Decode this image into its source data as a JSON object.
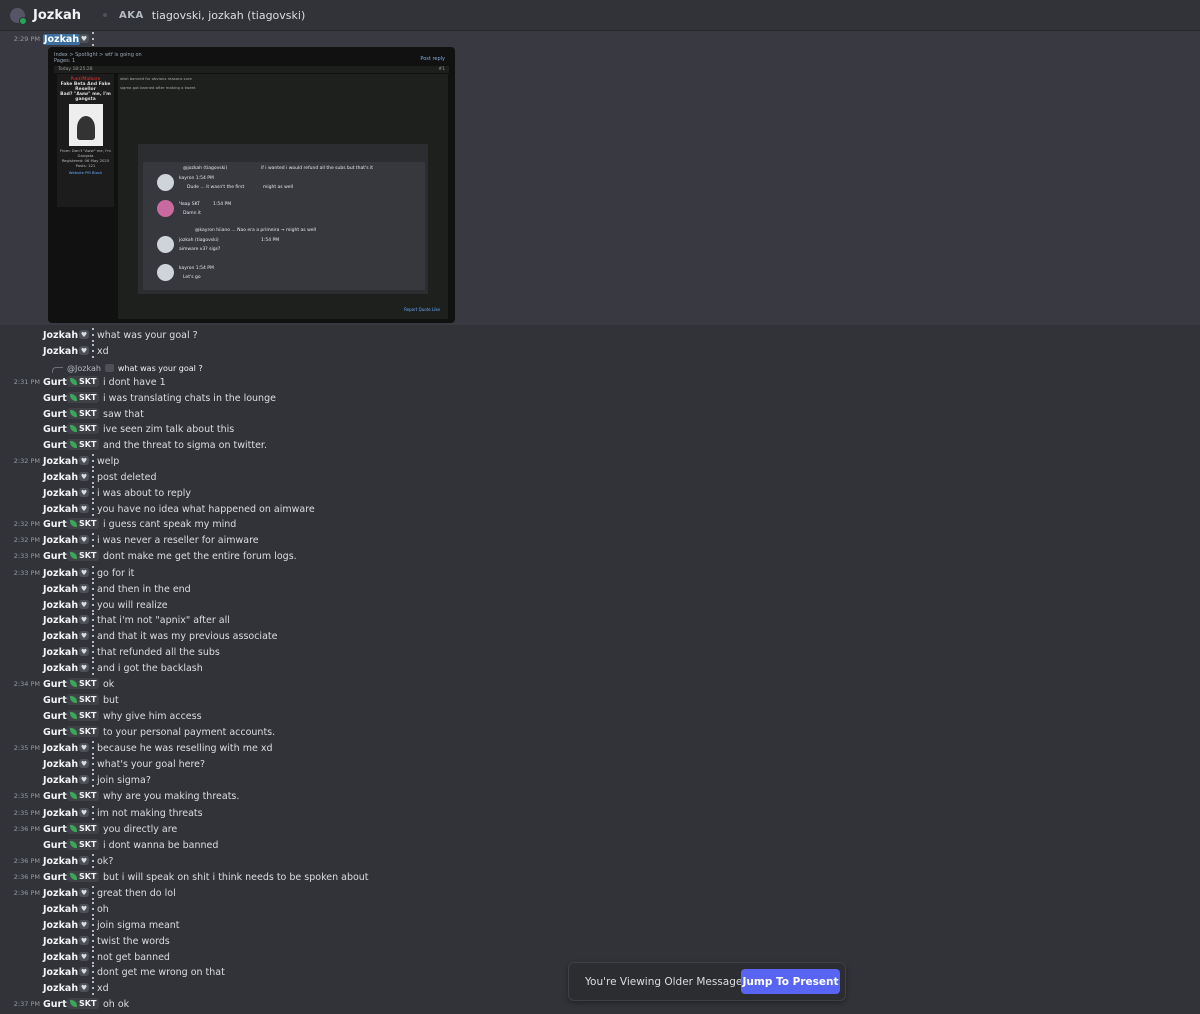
{
  "header": {
    "name": "Jozkah",
    "aka_label": "AKA",
    "aliases": "tiagovski, jozkah (tiagovski)"
  },
  "embed": {
    "breadcrumb": "Index > Spotlight > wtf is going on",
    "pages": "Pages: 1",
    "post_reply": "Post reply",
    "date": "Today 18:25:28",
    "post_no": "#1",
    "side_rank": "Ρυκέ/Μalbore",
    "side_sub": "Fake Beta And Fake Resellor",
    "side_caption": "Bad? \"Aww\" me, I'm gangsta",
    "side_info": [
      "From: Don't \"Aww\" me, I'm Gangsta",
      "Registered: 06 May 2025",
      "Posts: 121"
    ],
    "side_link": "Website PM Block",
    "intro_lines": [
      "wish banned for obvious reasons sure",
      "sigma got banned after making a tweet"
    ],
    "shot": {
      "m1": "@jozkah (tiagovski)",
      "m1_text": "if i wanted i would refund all the subs but that's it",
      "u1": "kayron 1:54 PM",
      "u1_text": "Dude ... it wasn't the first",
      "u1_side": "might as well",
      "u2": "Чвар SKT",
      "u2_time": "1:54 PM",
      "u2_text": "Damn it",
      "m2": "@kayron hiiano ... Nao era a primeira → might as well",
      "u3": "jozkah (tiagovski)",
      "u3_time": "1:54 PM",
      "u3_text": "aimware v3? sigs?",
      "u4": "kayron 1:54 PM",
      "u4_text": "Let's go"
    },
    "footer": "Report   Quote   Like"
  },
  "reply_preview": {
    "author": "@Jozkah",
    "text": "what was your goal ?"
  },
  "messages": [
    {
      "time": "2:29 PM",
      "user": "Jozkah",
      "text": ""
    },
    {
      "time": "",
      "user": "Jozkah",
      "text": "what was your goal ?"
    },
    {
      "time": "",
      "user": "Jozkah",
      "text": "xd"
    },
    {
      "time": "2:31 PM",
      "user": "Gurt",
      "tag": "SKT",
      "text": "i dont have 1"
    },
    {
      "time": "",
      "user": "Gurt",
      "tag": "SKT",
      "text": "i was translating chats in the lounge"
    },
    {
      "time": "",
      "user": "Gurt",
      "tag": "SKT",
      "text": "saw that"
    },
    {
      "time": "",
      "user": "Gurt",
      "tag": "SKT",
      "text": "ive seen zim talk about this"
    },
    {
      "time": "",
      "user": "Gurt",
      "tag": "SKT",
      "text": "and the threat to sigma on twitter."
    },
    {
      "time": "2:32 PM",
      "user": "Jozkah",
      "text": "welp"
    },
    {
      "time": "",
      "user": "Jozkah",
      "text": "post deleted"
    },
    {
      "time": "",
      "user": "Jozkah",
      "text": "i was about to reply"
    },
    {
      "time": "",
      "user": "Jozkah",
      "text": "you have no idea what happened on aimware"
    },
    {
      "time": "2:32 PM",
      "user": "Gurt",
      "tag": "SKT",
      "text": "i guess cant speak my mind"
    },
    {
      "time": "2:32 PM",
      "user": "Jozkah",
      "text": "i was never a reseller for aimware"
    },
    {
      "time": "2:33 PM",
      "user": "Gurt",
      "tag": "SKT",
      "text": "dont make me get the entire forum logs."
    },
    {
      "time": "2:33 PM",
      "user": "Jozkah",
      "text": "go for it"
    },
    {
      "time": "",
      "user": "Jozkah",
      "text": "and then in the end"
    },
    {
      "time": "",
      "user": "Jozkah",
      "text": "you will realize"
    },
    {
      "time": "",
      "user": "Jozkah",
      "text": "that i'm not \"apnix\" after all"
    },
    {
      "time": "",
      "user": "Jozkah",
      "text": "and that it was my previous associate"
    },
    {
      "time": "",
      "user": "Jozkah",
      "text": "that refunded all the subs"
    },
    {
      "time": "",
      "user": "Jozkah",
      "text": "and i got the backlash"
    },
    {
      "time": "2:34 PM",
      "user": "Gurt",
      "tag": "SKT",
      "text": "ok"
    },
    {
      "time": "",
      "user": "Gurt",
      "tag": "SKT",
      "text": "but"
    },
    {
      "time": "",
      "user": "Gurt",
      "tag": "SKT",
      "text": "why give him access"
    },
    {
      "time": "",
      "user": "Gurt",
      "tag": "SKT",
      "text": "to your personal payment accounts."
    },
    {
      "time": "2:35 PM",
      "user": "Jozkah",
      "text": "because he was reselling with me xd"
    },
    {
      "time": "",
      "user": "Jozkah",
      "text": "what's your goal here?"
    },
    {
      "time": "",
      "user": "Jozkah",
      "text": "join sigma?"
    },
    {
      "time": "2:35 PM",
      "user": "Gurt",
      "tag": "SKT",
      "text": "why are you making threats."
    },
    {
      "time": "2:35 PM",
      "user": "Jozkah",
      "text": "im not making threats"
    },
    {
      "time": "2:36 PM",
      "user": "Gurt",
      "tag": "SKT",
      "text": "you directly are"
    },
    {
      "time": "",
      "user": "Gurt",
      "tag": "SKT",
      "text": "i dont wanna be banned"
    },
    {
      "time": "2:36 PM",
      "user": "Jozkah",
      "text": "ok?"
    },
    {
      "time": "2:36 PM",
      "user": "Gurt",
      "tag": "SKT",
      "text": "but i will speak on shit i think needs to be spoken about"
    },
    {
      "time": "2:36 PM",
      "user": "Jozkah",
      "text": "great then do lol"
    },
    {
      "time": "",
      "user": "Jozkah",
      "text": "oh"
    },
    {
      "time": "",
      "user": "Jozkah",
      "text": "join sigma meant"
    },
    {
      "time": "",
      "user": "Jozkah",
      "text": "twist the words"
    },
    {
      "time": "",
      "user": "Jozkah",
      "text": "not get banned"
    },
    {
      "time": "",
      "user": "Jozkah",
      "text": "dont get me wrong on that"
    },
    {
      "time": "",
      "user": "Jozkah",
      "text": "xd"
    },
    {
      "time": "2:37 PM",
      "user": "Gurt",
      "tag": "SKT",
      "text": "oh ok"
    }
  ],
  "banner": {
    "text": "You're Viewing Older Messages",
    "button": "Jump To Present"
  },
  "colors": {
    "background": "#323339",
    "highlight": "#393a41",
    "accent": "#5865f2",
    "leaf": "#3ba55c"
  }
}
